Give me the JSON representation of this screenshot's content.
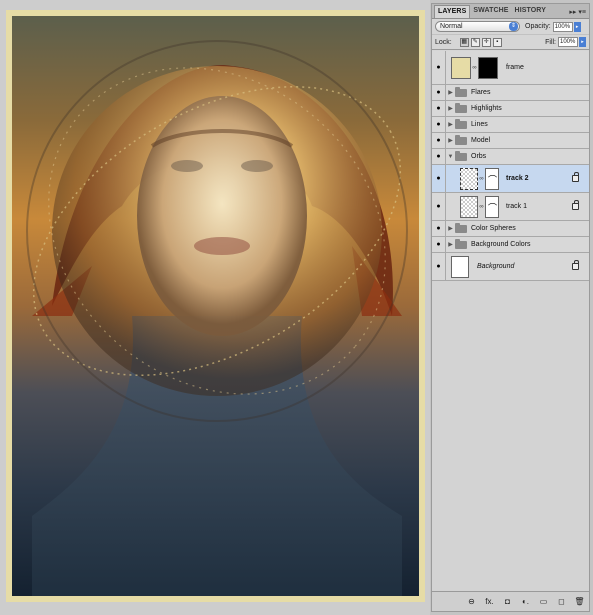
{
  "panel": {
    "tabs": [
      {
        "label": "LAYERS"
      },
      {
        "label": "SWATCHE"
      },
      {
        "label": "HISTORY"
      }
    ],
    "tab_menu": "▸▸ ▾≡",
    "blend_mode": "Normal",
    "opacity_label": "Opacity:",
    "opacity_value": "100%",
    "lock_label": "Lock:",
    "fill_label": "Fill:",
    "fill_value": "100%",
    "layers": [
      {
        "name": "frame",
        "type": "layer-mask"
      },
      {
        "name": "Flares",
        "type": "group"
      },
      {
        "name": "Highlights",
        "type": "group"
      },
      {
        "name": "Lines",
        "type": "group"
      },
      {
        "name": "Model",
        "type": "group"
      },
      {
        "name": "Orbs",
        "type": "group-open"
      },
      {
        "name": "track 2",
        "type": "track",
        "selected": true
      },
      {
        "name": "track 1",
        "type": "track"
      },
      {
        "name": "Color Spheres",
        "type": "group"
      },
      {
        "name": "Background Colors",
        "type": "group"
      },
      {
        "name": "Background",
        "type": "background"
      }
    ],
    "bottom_icons": [
      "link-icon",
      "fx-icon",
      "mask-icon",
      "adjustment-icon",
      "new-group-icon",
      "new-layer-icon",
      "trash-icon"
    ],
    "bottom_icon_glyphs": [
      "⊖",
      "fx.",
      "◘",
      "◐.",
      "▭",
      "◻",
      "🗑"
    ]
  },
  "colors": {
    "selection": "#c6d8ef",
    "accent": "#4a7fd4",
    "frame": "#e6dca6"
  }
}
